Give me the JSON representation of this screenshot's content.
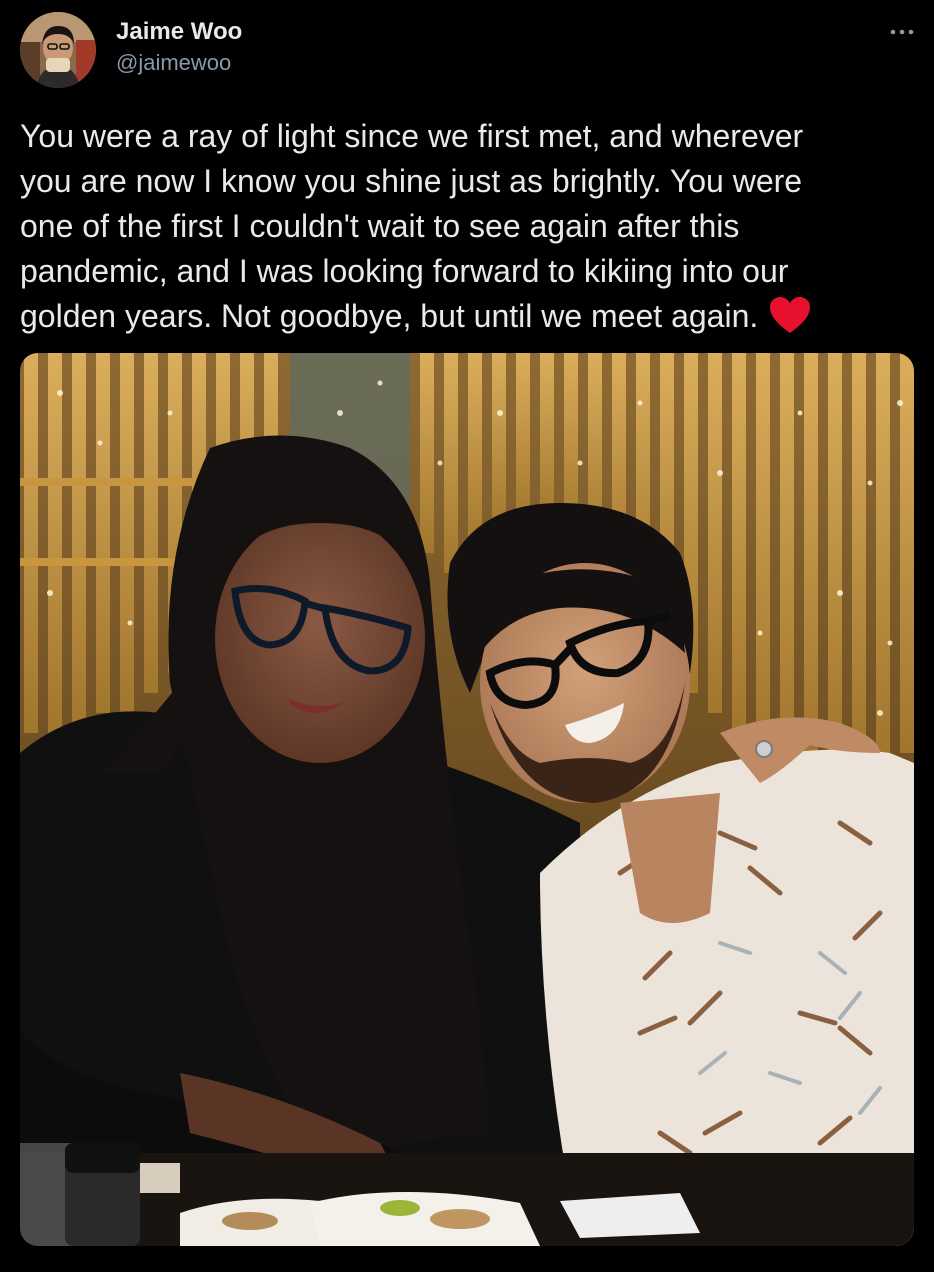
{
  "tweet": {
    "author_name": "Jaime Woo",
    "author_handle": "@jaimewoo",
    "more_icon": "more-horizontal-icon",
    "text": "You were a ray of light since we first met, and wherever\nyou are now I know you shine just as brightly. You were\none of the first I couldn't wait to see again after this\npandemic, and I was looking forward to kikiing into our\ngolden years. Not goodbye, but until we meet again.",
    "emoji": "red-heart-icon",
    "colors": {
      "background": "#000000",
      "text_primary": "#e7e9ea",
      "text_secondary": "#8b98a5",
      "heart": "#e8112d"
    }
  }
}
